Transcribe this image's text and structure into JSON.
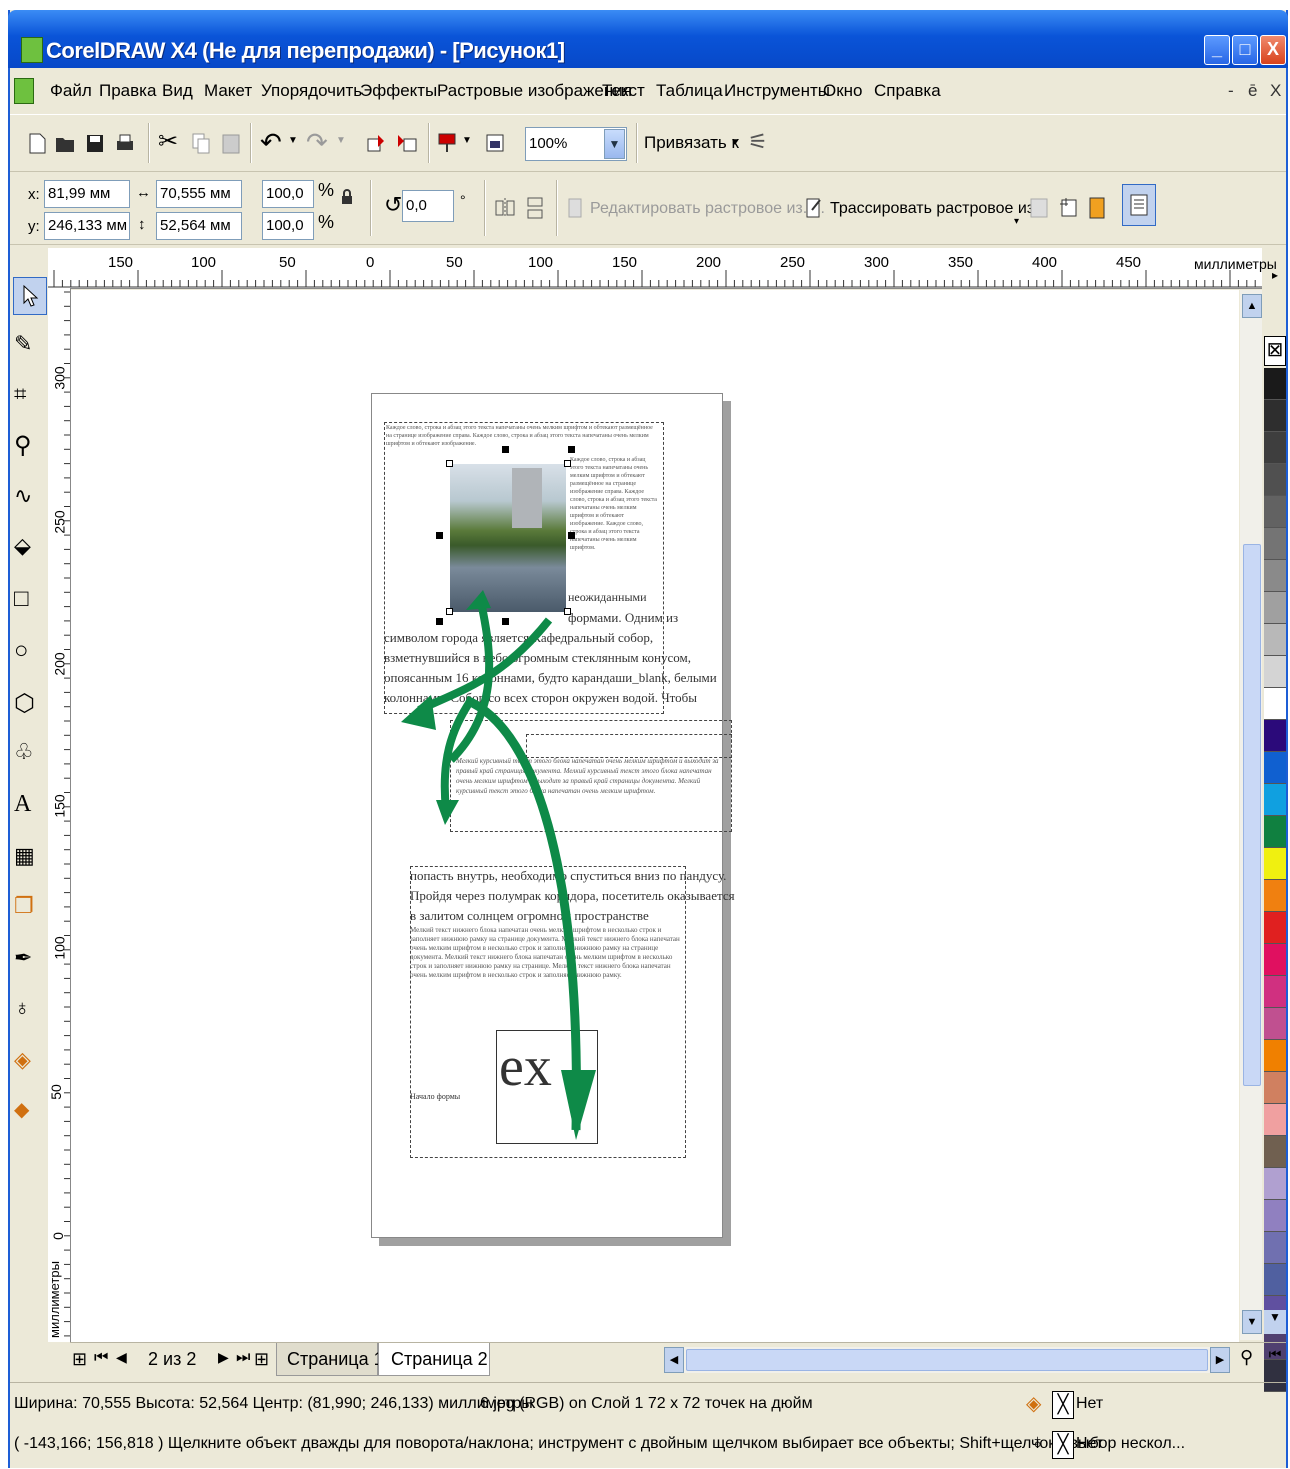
{
  "window": {
    "title": "CorelDRAW X4 (Не для перепродажи) - [Рисунок1]",
    "buttons": {
      "minimize": "_",
      "maximize": "□",
      "close": "X"
    }
  },
  "menu": {
    "items": [
      "Файл",
      "Правка",
      "Вид",
      "Макет",
      "Упорядочить",
      "Эффекты",
      "Растровые изображения",
      "Текст",
      "Таблица",
      "Инструменты",
      "Окно",
      "Справка"
    ],
    "mdi": {
      "minimize": "-",
      "restore": "ē",
      "close": "X"
    }
  },
  "toolbar": {
    "zoom_value": "100%",
    "snap_label": "Привязать к"
  },
  "properties": {
    "x_label": "x:",
    "x_value": "81,99 мм",
    "y_label": "y:",
    "y_value": "246,133 мм",
    "width_value": "70,555 мм",
    "height_value": "52,564 мм",
    "scale_x": "100,0",
    "scale_y": "100,0",
    "percent": "%",
    "rotation": "0,0",
    "degree": "°",
    "edit_bitmap": "Редактировать растровое из. ...",
    "trace_bitmap": "Трассировать растровое из."
  },
  "ruler": {
    "h_ticks": [
      "150",
      "100",
      "50",
      "0",
      "50",
      "100",
      "150",
      "200",
      "250",
      "300",
      "350",
      "400",
      "450"
    ],
    "h_unit": "миллиметры",
    "v_ticks": [
      "300",
      "250",
      "200",
      "150",
      "100",
      "50",
      "0"
    ],
    "v_unit": "миллиметры"
  },
  "document": {
    "lines_top": [
      "символом города является Кафедральный собор,",
      "взметнувшийся в небо огромным стеклянным конусом,",
      "опоясанным 16 колоннами, будто карандаши_blank, белыми",
      "колоннами. Собор со всех сторон окружен водой. Чтобы"
    ],
    "side_lines": [
      "неожиданными",
      "формами. Одним из"
    ],
    "link_text": "карандаши_blank",
    "lines_bottom": [
      "попасть внутрь, необходимо спуститься вниз по пандусу.",
      "Пройдя через полумрак коридора, посетитель оказывается",
      "в залитом солнцем огромном пространстве"
    ],
    "big_text": "ex",
    "small_text": "Начало формы"
  },
  "pages": {
    "counter": "2 из 2",
    "tabs": [
      "Страница 1",
      "Страница 2"
    ]
  },
  "status": {
    "line1": "Ширина: 70,555 Высота: 52,564 Центр: (81,990; 246,133) миллиметры",
    "object_info": "6.jpg (RGB) on Слой 1 72 x 72 точек на дюйм",
    "line2": "( -143,166; 156,818 )   Щелкните объект дважды для поворота/наклона; инструмент с двойным щелчком выбирает все объекты; Shift+щелчок - выбор нескол...",
    "fill_label": "Нет",
    "outline_label": "Нет"
  },
  "palette": [
    "#1a1a1a",
    "#2e2e2e",
    "#3e3e3e",
    "#505050",
    "#626262",
    "#747474",
    "#8a8a8a",
    "#a0a0a0",
    "#b8b8b8",
    "#d4d4d4",
    "#ffffff",
    "#2b0a7a",
    "#1060d0",
    "#10a0e0",
    "#108040",
    "#f0f010",
    "#f08010",
    "#e02020",
    "#e01060",
    "#d03080",
    "#c05090",
    "#f08000",
    "#d08060",
    "#f0a0a0",
    "#706050",
    "#b0a0d0",
    "#9080c0",
    "#7070b0",
    "#5060a0",
    "#6050a0",
    "#504070",
    "#303040"
  ]
}
